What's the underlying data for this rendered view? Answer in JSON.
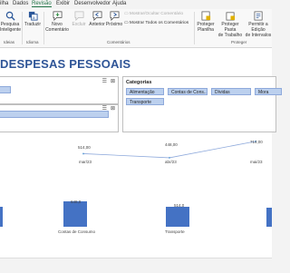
{
  "ribbon_tabs": [
    "ilha",
    "Dados",
    "Revisão",
    "Exibir",
    "Desenvolvedor",
    "Ajuda"
  ],
  "ribbon": {
    "pesquisa": [
      "Pesquisa",
      "Inteligente"
    ],
    "traduzir": "Traduzir",
    "novo_comentario": [
      "Novo",
      "Comentário"
    ],
    "excluir": "Excluir",
    "anterior": "Anterior",
    "proximo": "Próximo",
    "mostrar_ocultar": "Mostrar/Ocultar Comentário",
    "mostrar_todos": "Mostrar Todos os Comentários",
    "proteger_planilha": [
      "Proteger",
      "Planilha"
    ],
    "proteger_pasta": [
      "Proteger Pasta",
      "de Trabalho"
    ],
    "permitir_edicao": [
      "Permitir a Edição",
      "de Intervalos"
    ],
    "groups": {
      "ideias": "Ideias",
      "idioma": "Idioma",
      "comentarios": "Comentários",
      "proteger": "Proteger"
    }
  },
  "dashboard_title": "DESPESAS PESSOAIS",
  "slicer_categorias": {
    "title": "Categorias",
    "items": [
      "Alimentação",
      "Contas de Cons...",
      "Dívidas",
      "Mora",
      "Transporte"
    ]
  },
  "line_chart": {
    "labels": [
      "514,00",
      "448,00",
      "714,00"
    ],
    "x_ticks": [
      "mar/23",
      "abr/23",
      "mai/23"
    ]
  },
  "bar_chart": {
    "labels": [
      "648,0",
      "514,0"
    ],
    "x_ticks": [
      "Contas de Consumo",
      "Transporte"
    ]
  },
  "chart_data": [
    {
      "type": "line",
      "x": [
        "mar/23",
        "abr/23",
        "mai/23"
      ],
      "series": [
        {
          "values": [
            514.0,
            448.0,
            714.0
          ]
        }
      ],
      "title": "",
      "xlabel": "",
      "ylabel": ""
    },
    {
      "type": "bar",
      "categories": [
        "Contas de Consumo",
        "Transporte"
      ],
      "values": [
        648.0,
        514.0
      ],
      "title": "",
      "xlabel": "",
      "ylabel": ""
    }
  ],
  "colors": {
    "accent": "#217346",
    "title": "#2f5597",
    "bar": "#4472c4",
    "chip": "#bcd0ee"
  }
}
